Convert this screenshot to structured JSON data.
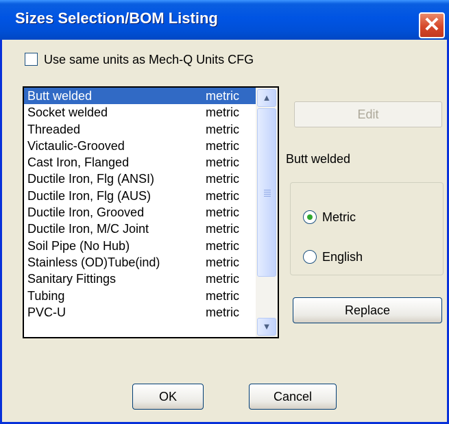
{
  "window": {
    "title": "Sizes Selection/BOM Listing",
    "close_glyph": "✕"
  },
  "options": {
    "same_units_label": "Use same units as Mech-Q Units CFG",
    "same_units_checked": false
  },
  "list": {
    "items": [
      {
        "name": "Butt welded",
        "unit": "metric"
      },
      {
        "name": "Socket welded",
        "unit": "metric"
      },
      {
        "name": "Threaded",
        "unit": "metric"
      },
      {
        "name": "Victaulic-Grooved",
        "unit": "metric"
      },
      {
        "name": "Cast Iron, Flanged",
        "unit": "metric"
      },
      {
        "name": "Ductile Iron, Flg (ANSI)",
        "unit": "metric"
      },
      {
        "name": "Ductile Iron, Flg (AUS)",
        "unit": "metric"
      },
      {
        "name": "Ductile Iron, Grooved",
        "unit": "metric"
      },
      {
        "name": "Ductile Iron, M/C Joint",
        "unit": "metric"
      },
      {
        "name": "Soil Pipe (No Hub)",
        "unit": "metric"
      },
      {
        "name": "Stainless (OD)Tube(ind)",
        "unit": "metric"
      },
      {
        "name": "Sanitary Fittings",
        "unit": "metric"
      },
      {
        "name": "Tubing",
        "unit": "metric"
      },
      {
        "name": "PVC-U",
        "unit": "metric"
      }
    ],
    "selected_index": 0,
    "scroll_up_glyph": "▲",
    "scroll_down_glyph": "▼"
  },
  "edit_panel": {
    "edit_label": "Edit",
    "selected_name": "Butt welded",
    "metric_label": "Metric",
    "english_label": "English",
    "selected_unit": "Metric",
    "replace_label": "Replace"
  },
  "footer": {
    "ok_label": "OK",
    "cancel_label": "Cancel"
  }
}
